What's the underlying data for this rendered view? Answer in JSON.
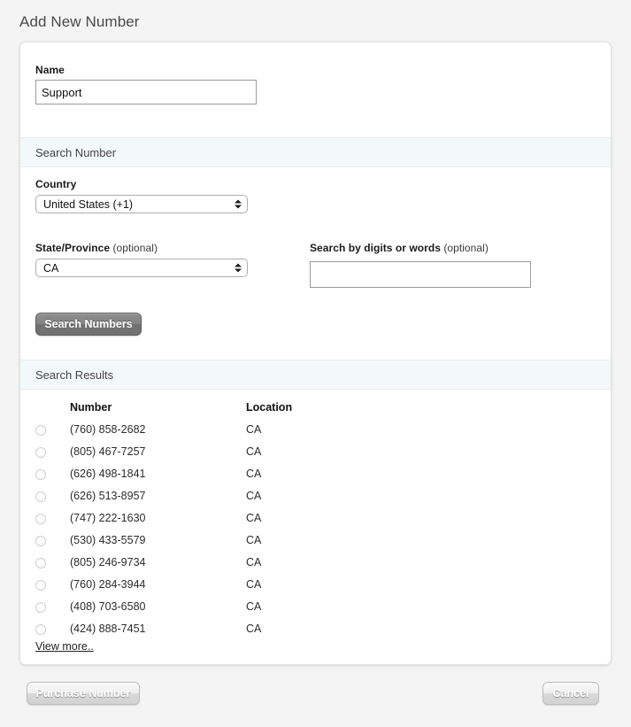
{
  "page": {
    "title": "Add New Number"
  },
  "form": {
    "name_label": "Name",
    "name_value": "Support",
    "name_placeholder": ""
  },
  "search_section": {
    "header": "Search Number",
    "country_label": "Country",
    "country_value": "United States (+1)",
    "state_label": "State/Province",
    "state_label_optional": "(optional)",
    "state_value": "CA",
    "digits_label": "Search by digits or words",
    "digits_label_optional": "(optional)",
    "digits_value": "",
    "digits_placeholder": "",
    "search_button": "Search Numbers"
  },
  "results_section": {
    "header": "Search Results",
    "columns": {
      "number": "Number",
      "location": "Location"
    },
    "rows": [
      {
        "number": "(760) 858-2682",
        "location": "CA"
      },
      {
        "number": "(805) 467-7257",
        "location": "CA"
      },
      {
        "number": "(626) 498-1841",
        "location": "CA"
      },
      {
        "number": "(626) 513-8957",
        "location": "CA"
      },
      {
        "number": "(747) 222-1630",
        "location": "CA"
      },
      {
        "number": "(530) 433-5579",
        "location": "CA"
      },
      {
        "number": "(805) 246-9734",
        "location": "CA"
      },
      {
        "number": "(760) 284-3944",
        "location": "CA"
      },
      {
        "number": "(408) 703-6580",
        "location": "CA"
      },
      {
        "number": "(424) 888-7451",
        "location": "CA"
      }
    ],
    "view_more": "View more.."
  },
  "footer": {
    "purchase_button": "Purchase Number",
    "cancel_button": "Cancel"
  },
  "colors": {
    "page_background": "#f4f4f4",
    "card_background": "#ffffff",
    "section_band": "#f3f8fa",
    "primary_button": "#7a7a7a",
    "secondary_button": "#e6e6e6"
  }
}
